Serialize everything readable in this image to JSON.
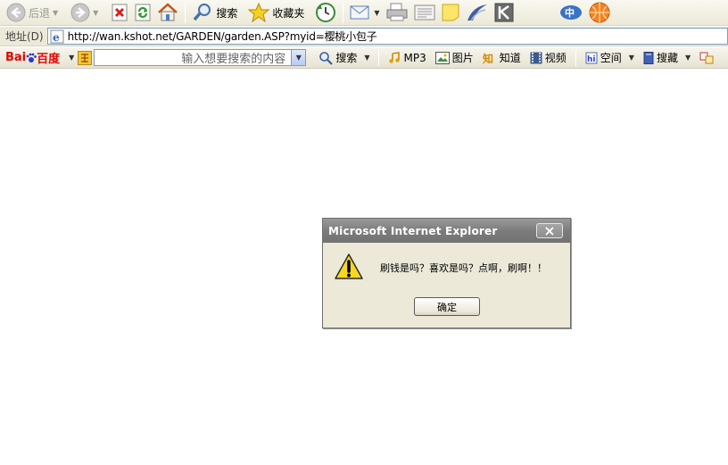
{
  "toolbar": {
    "back_label": "后退",
    "search_label": "搜索",
    "favorites_label": "收藏夹"
  },
  "address": {
    "label": "地址(D)",
    "url": "http://wan.kshot.net/GARDEN/garden.ASP?myid=樱桃小包子"
  },
  "baidu": {
    "logo_a": "Bai",
    "logo_b": "百度",
    "search_placeholder": "输入想要搜索的内容",
    "search_label": "搜索",
    "mp3_label": "MP3",
    "images_label": "图片",
    "zhidao_label": "知道",
    "video_label": "视频",
    "space_label": "空间",
    "collect_label": "搜藏"
  },
  "dialog": {
    "title": "Microsoft Internet Explorer",
    "message": "刷钱是吗？喜欢是吗？点啊，刷啊！！",
    "ok_label": "确定"
  },
  "colors": {
    "chrome": "#ece9d8",
    "dialog_title": "#7c7c7c",
    "address_border": "#7f9db9"
  }
}
